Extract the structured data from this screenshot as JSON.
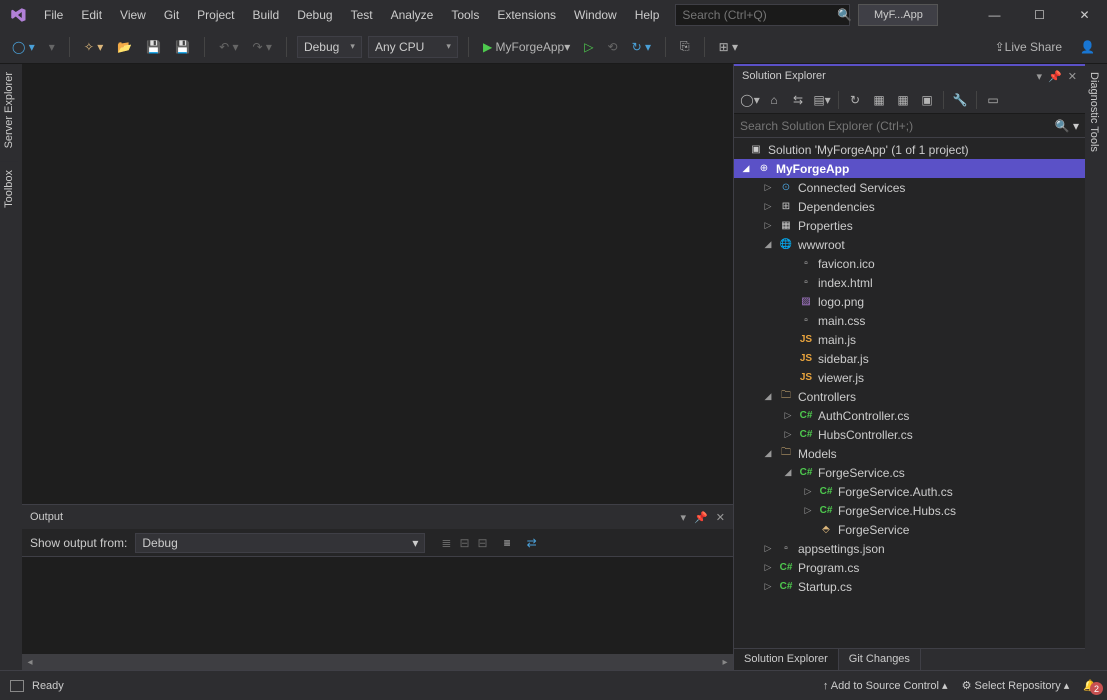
{
  "titlebar": {
    "menus": [
      "File",
      "Edit",
      "View",
      "Git",
      "Project",
      "Build",
      "Debug",
      "Test",
      "Analyze",
      "Tools",
      "Extensions",
      "Window",
      "Help"
    ],
    "searchPlaceholder": "Search (Ctrl+Q)",
    "solutionSlot": "MyF...App"
  },
  "toolbar": {
    "config": "Debug",
    "platform": "Any CPU",
    "startTarget": "MyForgeApp",
    "liveShare": "Live Share"
  },
  "leftTabs": [
    "Server Explorer",
    "Toolbox"
  ],
  "rightTabs": [
    "Diagnostic Tools"
  ],
  "output": {
    "title": "Output",
    "showFromLabel": "Show output from:",
    "source": "Debug"
  },
  "solutionExplorer": {
    "title": "Solution Explorer",
    "searchPlaceholder": "Search Solution Explorer (Ctrl+;)",
    "rootLabel": "Solution 'MyForgeApp' (1 of 1 project)",
    "project": "MyForgeApp",
    "nodes": {
      "connected": "Connected Services",
      "deps": "Dependencies",
      "props": "Properties",
      "wwwroot": "wwwroot",
      "favicon": "favicon.ico",
      "indexhtml": "index.html",
      "logo": "logo.png",
      "maincss": "main.css",
      "mainjs": "main.js",
      "sidebarjs": "sidebar.js",
      "viewerjs": "viewer.js",
      "controllers": "Controllers",
      "authctrl": "AuthController.cs",
      "hubsctrl": "HubsController.cs",
      "models": "Models",
      "forgesvc": "ForgeService.cs",
      "forgeauth": "ForgeService.Auth.cs",
      "forgehubs": "ForgeService.Hubs.cs",
      "forgesvcclass": "ForgeService",
      "appsettings": "appsettings.json",
      "program": "Program.cs",
      "startup": "Startup.cs"
    },
    "bottomTabs": [
      "Solution Explorer",
      "Git Changes"
    ]
  },
  "statusbar": {
    "ready": "Ready",
    "addSource": "Add to Source Control",
    "selectRepo": "Select Repository",
    "notifCount": "2"
  }
}
